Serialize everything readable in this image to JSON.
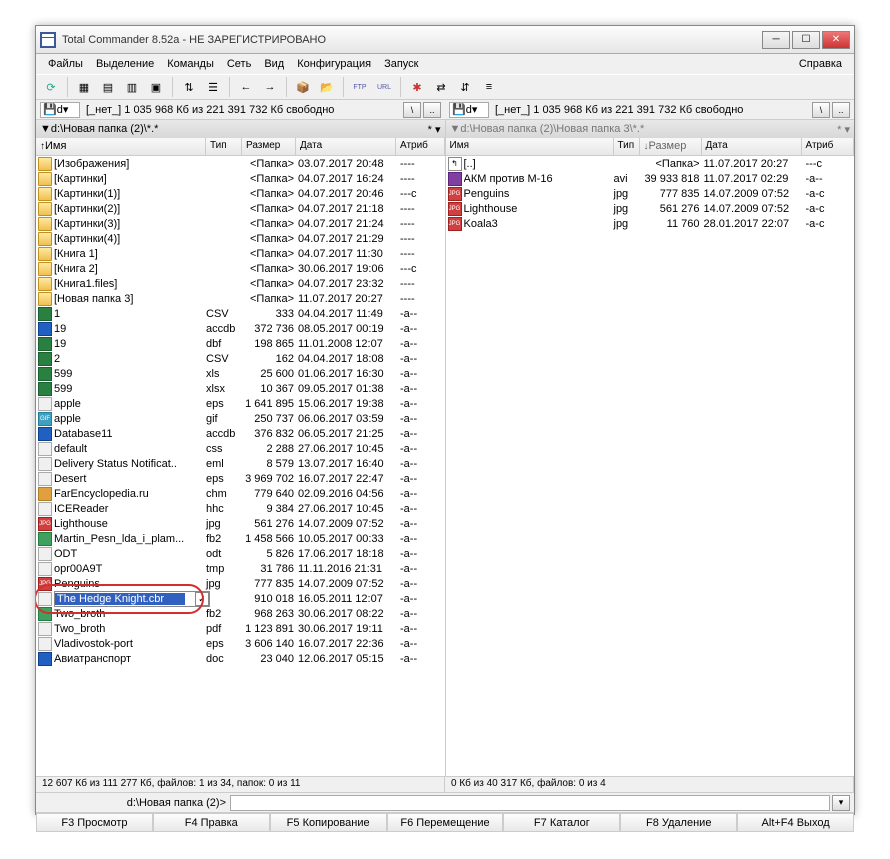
{
  "title": "Total Commander 8.52a - НЕ ЗАРЕГИСТРИРОВАНО",
  "menu": [
    "Файлы",
    "Выделение",
    "Команды",
    "Сеть",
    "Вид",
    "Конфигурация",
    "Запуск"
  ],
  "menu_help": "Справка",
  "drive_label": "d",
  "drive_info_left": "[_нет_]  1 035 968 Кб из 221 391 732 Кб свободно",
  "drive_info_right": "[_нет_]  1 035 968 Кб из 221 391 732 Кб свободно",
  "path_left": "d:\\Новая папка (2)\\*.*",
  "path_right": "d:\\Новая папка (2)\\Новая папка 3\\*.*",
  "headers": {
    "name": "Имя",
    "ext": "Тип",
    "size": "Размер",
    "date": "Дата",
    "attr": "Атриб"
  },
  "left_files": [
    {
      "ic": "folder",
      "name": "[Изображения]",
      "ext": "",
      "size": "<Папка>",
      "date": "03.07.2017 20:48",
      "attr": "----"
    },
    {
      "ic": "folder",
      "name": "[Картинки]",
      "ext": "",
      "size": "<Папка>",
      "date": "04.07.2017 16:24",
      "attr": "----"
    },
    {
      "ic": "folder",
      "name": "[Картинки(1)]",
      "ext": "",
      "size": "<Папка>",
      "date": "04.07.2017 20:46",
      "attr": "---c"
    },
    {
      "ic": "folder",
      "name": "[Картинки(2)]",
      "ext": "",
      "size": "<Папка>",
      "date": "04.07.2017 21:18",
      "attr": "----"
    },
    {
      "ic": "folder",
      "name": "[Картинки(3)]",
      "ext": "",
      "size": "<Папка>",
      "date": "04.07.2017 21:24",
      "attr": "----"
    },
    {
      "ic": "folder",
      "name": "[Картинки(4)]",
      "ext": "",
      "size": "<Папка>",
      "date": "04.07.2017 21:29",
      "attr": "----"
    },
    {
      "ic": "folder",
      "name": "[Книга 1]",
      "ext": "",
      "size": "<Папка>",
      "date": "04.07.2017 11:30",
      "attr": "----"
    },
    {
      "ic": "folder",
      "name": "[Книга 2]",
      "ext": "",
      "size": "<Папка>",
      "date": "30.06.2017 19:06",
      "attr": "---c"
    },
    {
      "ic": "folder",
      "name": "[Книга1.files]",
      "ext": "",
      "size": "<Папка>",
      "date": "04.07.2017 23:32",
      "attr": "----"
    },
    {
      "ic": "folder",
      "name": "[Новая папка 3]",
      "ext": "",
      "size": "<Папка>",
      "date": "11.07.2017 20:27",
      "attr": "----"
    },
    {
      "ic": "xls",
      "name": "1",
      "ext": "CSV",
      "size": "333",
      "date": "04.04.2017 11:49",
      "attr": "-a--"
    },
    {
      "ic": "doc",
      "name": "19",
      "ext": "accdb",
      "size": "372 736",
      "date": "08.05.2017 00:19",
      "attr": "-a--"
    },
    {
      "ic": "xls",
      "name": "19",
      "ext": "dbf",
      "size": "198 865",
      "date": "11.01.2008 12:07",
      "attr": "-a--"
    },
    {
      "ic": "xls",
      "name": "2",
      "ext": "CSV",
      "size": "162",
      "date": "04.04.2017 18:08",
      "attr": "-a--"
    },
    {
      "ic": "xls",
      "name": "599",
      "ext": "xls",
      "size": "25 600",
      "date": "01.06.2017 16:30",
      "attr": "-a--"
    },
    {
      "ic": "xls",
      "name": "599",
      "ext": "xlsx",
      "size": "10 367",
      "date": "09.05.2017 01:38",
      "attr": "-a--"
    },
    {
      "ic": "file",
      "name": "apple",
      "ext": "eps",
      "size": "1 641 895",
      "date": "15.06.2017 19:38",
      "attr": "-a--"
    },
    {
      "ic": "gif",
      "name": "apple",
      "ext": "gif",
      "size": "250 737",
      "date": "06.06.2017 03:59",
      "attr": "-a--"
    },
    {
      "ic": "doc",
      "name": "Database11",
      "ext": "accdb",
      "size": "376 832",
      "date": "06.05.2017 21:25",
      "attr": "-a--"
    },
    {
      "ic": "file",
      "name": "default",
      "ext": "css",
      "size": "2 288",
      "date": "27.06.2017 10:45",
      "attr": "-a--"
    },
    {
      "ic": "file",
      "name": "Delivery Status Notificat..",
      "ext": "eml",
      "size": "8 579",
      "date": "13.07.2017 16:40",
      "attr": "-a--"
    },
    {
      "ic": "file",
      "name": "Desert",
      "ext": "eps",
      "size": "3 969 702",
      "date": "16.07.2017 22:47",
      "attr": "-a--"
    },
    {
      "ic": "chm",
      "name": "FarEncyclopedia.ru",
      "ext": "chm",
      "size": "779 640",
      "date": "02.09.2016 04:56",
      "attr": "-a--"
    },
    {
      "ic": "file",
      "name": "ICEReader",
      "ext": "hhc",
      "size": "9 384",
      "date": "27.06.2017 10:45",
      "attr": "-a--"
    },
    {
      "ic": "img",
      "name": "Lighthouse",
      "ext": "jpg",
      "size": "561 276",
      "date": "14.07.2009 07:52",
      "attr": "-a--"
    },
    {
      "ic": "fb2",
      "name": "Martin_Pesn_lda_i_plam...",
      "ext": "fb2",
      "size": "1 458 566",
      "date": "10.05.2017 00:33",
      "attr": "-a--"
    },
    {
      "ic": "file",
      "name": "ODT",
      "ext": "odt",
      "size": "5 826",
      "date": "17.06.2017 18:18",
      "attr": "-a--"
    },
    {
      "ic": "file",
      "name": "opr00A9T",
      "ext": "tmp",
      "size": "31 786",
      "date": "11.11.2016 21:31",
      "attr": "-a--"
    },
    {
      "ic": "img",
      "name": "Penguins",
      "ext": "jpg",
      "size": "777 835",
      "date": "14.07.2009 07:52",
      "attr": "-a--"
    },
    {
      "ic": "file",
      "name": "",
      "ext": "",
      "size": "910 018",
      "date": "16.05.2011 12:07",
      "attr": "-a--"
    },
    {
      "ic": "fb2",
      "name": "Two_broth",
      "ext": "fb2",
      "size": "968 263",
      "date": "30.06.2017 08:22",
      "attr": "-a--"
    },
    {
      "ic": "file",
      "name": "Two_broth",
      "ext": "pdf",
      "size": "1 123 891",
      "date": "30.06.2017 19:11",
      "attr": "-a--"
    },
    {
      "ic": "file",
      "name": "Vladivostok-port",
      "ext": "eps",
      "size": "3 606 140",
      "date": "16.07.2017 22:36",
      "attr": "-a--"
    },
    {
      "ic": "doc",
      "name": "Авиатранспорт",
      "ext": "doc",
      "size": "23 040",
      "date": "12.06.2017 05:15",
      "attr": "-a--"
    }
  ],
  "rename_value": "The Hedge Knight.cbr",
  "right_files": [
    {
      "ic": "up",
      "name": "[..]",
      "ext": "",
      "size": "<Папка>",
      "date": "11.07.2017 20:27",
      "attr": "---c"
    },
    {
      "ic": "avi",
      "name": "АКМ против М-16",
      "ext": "avi",
      "size": "39 933 818",
      "date": "11.07.2017 02:29",
      "attr": "-a--"
    },
    {
      "ic": "img",
      "name": "Penguins",
      "ext": "jpg",
      "size": "777 835",
      "date": "14.07.2009 07:52",
      "attr": "-a-c"
    },
    {
      "ic": "img",
      "name": "Lighthouse",
      "ext": "jpg",
      "size": "561 276",
      "date": "14.07.2009 07:52",
      "attr": "-a-c"
    },
    {
      "ic": "img",
      "name": "Koala3",
      "ext": "jpg",
      "size": "11 760",
      "date": "28.01.2017 22:07",
      "attr": "-a-c"
    }
  ],
  "status_left": "12 607 Кб из 111 277 Кб, файлов: 1 из 34, папок: 0 из 11",
  "status_right": "0 Кб из 40 317 Кб, файлов: 0 из 4",
  "cmd_path": "d:\\Новая папка (2)>",
  "fn_buttons": [
    "F3 Просмотр",
    "F4 Правка",
    "F5 Копирование",
    "F6 Перемещение",
    "F7 Каталог",
    "F8 Удаление",
    "Alt+F4 Выход"
  ]
}
